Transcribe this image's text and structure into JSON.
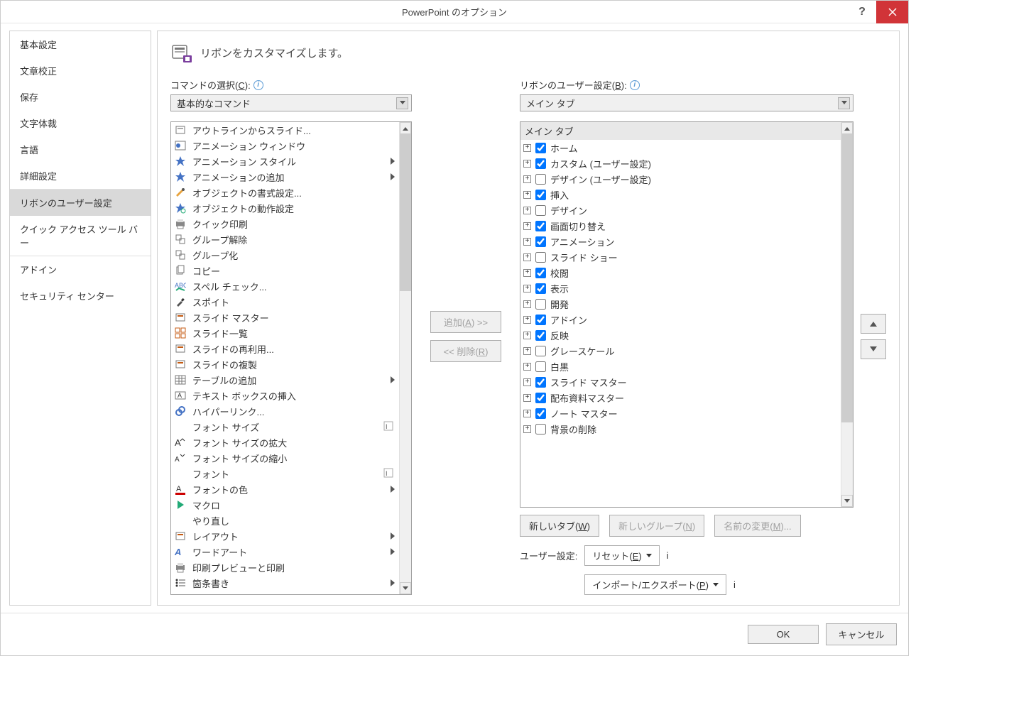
{
  "title": "PowerPoint のオプション",
  "sidebar": {
    "items": [
      {
        "label": "基本設定"
      },
      {
        "label": "文章校正"
      },
      {
        "label": "保存"
      },
      {
        "label": "文字体裁"
      },
      {
        "label": "言語"
      },
      {
        "label": "詳細設定"
      },
      {
        "label": "リボンのユーザー設定",
        "active": true
      },
      {
        "label": "クイック アクセス ツール バー"
      },
      {
        "label": "アドイン"
      },
      {
        "label": "セキュリティ センター"
      }
    ]
  },
  "header": {
    "title": "リボンをカスタマイズします。"
  },
  "left": {
    "label": "コマンドの選択(C):",
    "label_key": "C",
    "combo": "基本的なコマンド",
    "items": [
      {
        "text": "アウトラインからスライド...",
        "icon": "slide"
      },
      {
        "text": "アニメーション ウィンドウ",
        "icon": "anim-pane"
      },
      {
        "text": "アニメーション スタイル",
        "icon": "star",
        "submenu": true
      },
      {
        "text": "アニメーションの追加",
        "icon": "star-plus",
        "submenu": true
      },
      {
        "text": "オブジェクトの書式設定...",
        "icon": "format"
      },
      {
        "text": "オブジェクトの動作設定",
        "icon": "action"
      },
      {
        "text": "クイック印刷",
        "icon": "print"
      },
      {
        "text": "グループ解除",
        "icon": "ungroup"
      },
      {
        "text": "グループ化",
        "icon": "group"
      },
      {
        "text": "コピー",
        "icon": "copy"
      },
      {
        "text": "スペル チェック...",
        "icon": "spell"
      },
      {
        "text": "スポイト",
        "icon": "eyedropper"
      },
      {
        "text": "スライド マスター",
        "icon": "master"
      },
      {
        "text": "スライド一覧",
        "icon": "sorter"
      },
      {
        "text": "スライドの再利用...",
        "icon": "reuse"
      },
      {
        "text": "スライドの複製",
        "icon": "duplicate"
      },
      {
        "text": "テーブルの追加",
        "icon": "table",
        "submenu": true
      },
      {
        "text": "テキスト ボックスの挿入",
        "icon": "textbox"
      },
      {
        "text": "ハイパーリンク...",
        "icon": "link"
      },
      {
        "text": "フォント サイズ",
        "icon": "",
        "edit": true
      },
      {
        "text": "フォント サイズの拡大",
        "icon": "font-grow"
      },
      {
        "text": "フォント サイズの縮小",
        "icon": "font-shrink"
      },
      {
        "text": "フォント",
        "icon": "",
        "edit": true
      },
      {
        "text": "フォントの色",
        "icon": "font-color",
        "submenu": true
      },
      {
        "text": "マクロ",
        "icon": "play"
      },
      {
        "text": "やり直し",
        "icon": ""
      },
      {
        "text": "レイアウト",
        "icon": "layout",
        "submenu": true
      },
      {
        "text": "ワードアート",
        "icon": "wordart",
        "submenu": true
      },
      {
        "text": "印刷プレビューと印刷",
        "icon": "print-preview"
      },
      {
        "text": "箇条書き",
        "icon": "bullets",
        "submenu": true
      }
    ]
  },
  "right": {
    "label": "リボンのユーザー設定(B):",
    "label_key": "B",
    "combo": "メイン タブ",
    "tree_header": "メイン タブ",
    "items": [
      {
        "text": "ホーム",
        "checked": true
      },
      {
        "text": "カスタム (ユーザー設定)",
        "checked": true
      },
      {
        "text": "デザイン (ユーザー設定)",
        "checked": false
      },
      {
        "text": "挿入",
        "checked": true
      },
      {
        "text": "デザイン",
        "checked": false
      },
      {
        "text": "画面切り替え",
        "checked": true
      },
      {
        "text": "アニメーション",
        "checked": true
      },
      {
        "text": "スライド ショー",
        "checked": false
      },
      {
        "text": "校閲",
        "checked": true
      },
      {
        "text": "表示",
        "checked": true
      },
      {
        "text": "開発",
        "checked": false
      },
      {
        "text": "アドイン",
        "checked": true
      },
      {
        "text": "反映",
        "checked": true
      },
      {
        "text": "グレースケール",
        "checked": false
      },
      {
        "text": "白黒",
        "checked": false
      },
      {
        "text": "スライド マスター",
        "checked": true
      },
      {
        "text": "配布資料マスター",
        "checked": true
      },
      {
        "text": "ノート マスター",
        "checked": true
      },
      {
        "text": "背景の削除",
        "checked": false
      }
    ],
    "buttons": {
      "new_tab": "新しいタブ(W)",
      "new_group": "新しいグループ(N)",
      "rename": "名前の変更(M)..."
    },
    "settings_label": "ユーザー設定:",
    "reset": "リセット(E)",
    "import_export": "インポート/エクスポート(P)"
  },
  "mid": {
    "add": "追加(A) >>",
    "remove": "<< 削除(R)"
  },
  "footer": {
    "ok": "OK",
    "cancel": "キャンセル"
  }
}
